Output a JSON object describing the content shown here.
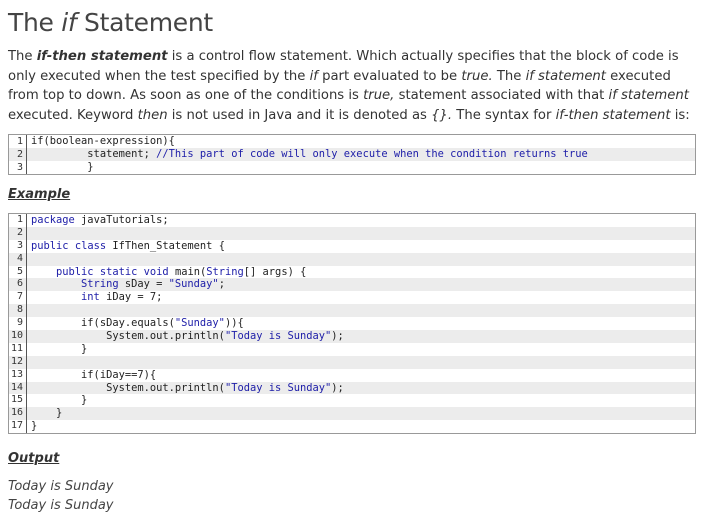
{
  "title": {
    "prefix": "The ",
    "emph": "if",
    "suffix": " Statement"
  },
  "intro": [
    {
      "t": "The ",
      "s": "n"
    },
    {
      "t": "if-then statement",
      "s": "b"
    },
    {
      "t": " is a control flow statement. Which actually specifies that the block of code is only executed when the test specified by the ",
      "s": "n"
    },
    {
      "t": "if",
      "s": "i"
    },
    {
      "t": " part evaluated to be ",
      "s": "n"
    },
    {
      "t": "true.",
      "s": "i"
    },
    {
      "t": " The ",
      "s": "n"
    },
    {
      "t": "if statement",
      "s": "i"
    },
    {
      "t": " executed from top to down. As soon as one of the conditions is ",
      "s": "n"
    },
    {
      "t": "true,",
      "s": "i"
    },
    {
      "t": " statement associated with that ",
      "s": "n"
    },
    {
      "t": "if statement",
      "s": "i"
    },
    {
      "t": " executed. Keyword ",
      "s": "n"
    },
    {
      "t": "then",
      "s": "i"
    },
    {
      "t": " is not used in Java and it is denoted as ",
      "s": "n"
    },
    {
      "t": "{}.",
      "s": "i"
    },
    {
      "t": " The syntax for ",
      "s": "n"
    },
    {
      "t": "if-then statement",
      "s": "i"
    },
    {
      "t": " is:",
      "s": "n"
    }
  ],
  "syntax_code": [
    {
      "n": "1",
      "text": "if(boolean-expression){"
    },
    {
      "n": "2",
      "text": "         statement; //This part of code will only execute when the condition returns true"
    },
    {
      "n": "3",
      "text": "         }"
    }
  ],
  "example_heading": "Example",
  "example_code": [
    {
      "n": "1",
      "text": "package javaTutorials;"
    },
    {
      "n": "2",
      "text": ""
    },
    {
      "n": "3",
      "text": "public class IfThen_Statement {"
    },
    {
      "n": "4",
      "text": ""
    },
    {
      "n": "5",
      "text": "    public static void main(String[] args) {"
    },
    {
      "n": "6",
      "text": "        String sDay = \"Sunday\";"
    },
    {
      "n": "7",
      "text": "        int iDay = 7;"
    },
    {
      "n": "8",
      "text": ""
    },
    {
      "n": "9",
      "text": "        if(sDay.equals(\"Sunday\")){"
    },
    {
      "n": "10",
      "text": "            System.out.println(\"Today is Sunday\");"
    },
    {
      "n": "11",
      "text": "        }"
    },
    {
      "n": "12",
      "text": ""
    },
    {
      "n": "13",
      "text": "        if(iDay==7){"
    },
    {
      "n": "14",
      "text": "            System.out.println(\"Today is Sunday\");"
    },
    {
      "n": "15",
      "text": "        }"
    },
    {
      "n": "16",
      "text": "    }"
    },
    {
      "n": "17",
      "text": "}"
    }
  ],
  "output_heading": "Output",
  "output_lines": [
    "Today is Sunday",
    "Today is Sunday"
  ],
  "colors": {
    "keyword": "#1d1da8",
    "border": "#999999",
    "stripe": "#ececec"
  }
}
